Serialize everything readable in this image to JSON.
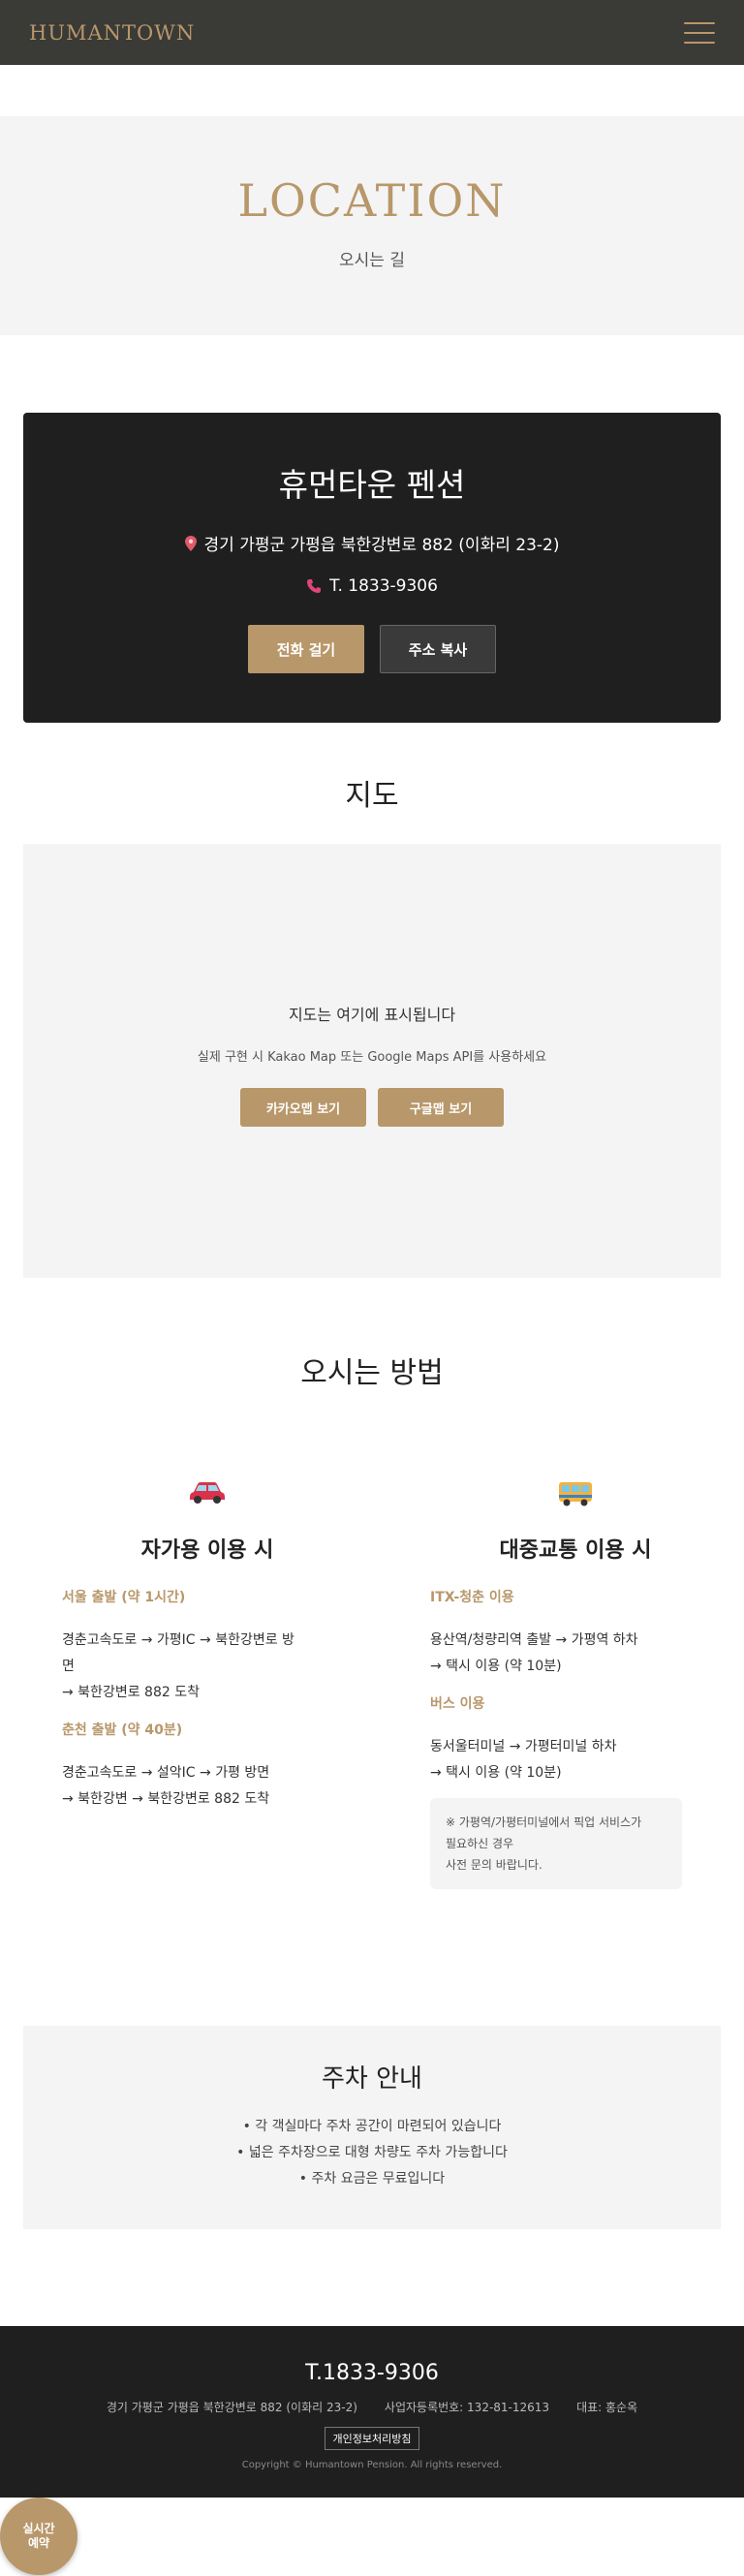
{
  "colors": {
    "accent": "#b8976a",
    "header_bg": "#3a3a37",
    "dark_bg": "#1f1f1f",
    "light_bg": "#f4f4f4"
  },
  "header": {
    "logo": "HUMANTOWN",
    "menu_icon": "hamburger-icon"
  },
  "hero": {
    "title": "LOCATION",
    "subtitle": "오시는 길"
  },
  "info": {
    "title": "휴먼타운 펜션",
    "address": "경기 가평군 가평읍 북한강변로 882 (이화리 23-2)",
    "phone": "T. 1833-9306",
    "call_button": "전화 걸기",
    "copy_button": "주소 복사",
    "address_icon": "map-pin-icon",
    "phone_icon": "phone-icon"
  },
  "map": {
    "title": "지도",
    "placeholder": "지도는 여기에 표시됩니다",
    "note": "실제 구현 시 Kakao Map 또는 Google Maps API를 사용하세요",
    "kakao_button": "카카오맵 보기",
    "google_button": "구글맵 보기"
  },
  "directions": {
    "title": "오시는 방법",
    "car": {
      "icon": "car-icon",
      "title": "자가용 이용 시",
      "routes": [
        {
          "head": "서울 출발 (약 1시간)",
          "lines": [
            "경춘고속도로 → 가평IC → 북한강변로 방",
            "면",
            "→ 북한강변로 882 도착"
          ]
        },
        {
          "head": "춘천 출발 (약 40분)",
          "lines": [
            "경춘고속도로 → 설악IC → 가평 방면",
            "→ 북한강변 → 북한강변로 882 도착"
          ]
        }
      ]
    },
    "transit": {
      "icon": "bus-icon",
      "title": "대중교통 이용 시",
      "routes": [
        {
          "head": "ITX-청춘 이용",
          "lines": [
            "용산역/청량리역 출발 → 가평역 하차",
            "→ 택시 이용 (약 10분)"
          ]
        },
        {
          "head": "버스 이용",
          "lines": [
            "동서울터미널 → 가평터미널 하차",
            "→ 택시 이용 (약 10분)"
          ]
        }
      ],
      "note": [
        "※ 가평역/가평터미널에서 픽업 서비스가",
        "필요하신 경우",
        "사전 문의 바랍니다."
      ]
    }
  },
  "parking": {
    "title": "주차 안내",
    "items": [
      "• 각 객실마다 주차 공간이 마련되어 있습니다",
      "• 넓은 주차장으로 대형 차량도 주차 가능합니다",
      "• 주차 요금은 무료입니다"
    ]
  },
  "footer": {
    "phone": "T.1833-9306",
    "address": "경기 가평군 가평읍 북한강변로 882 (이화리 23-2)",
    "biz_no": "사업자등록번호: 132-81-12613",
    "ceo": "대표: 홍순옥",
    "policy": "개인정보처리방침",
    "copyright": "Copyright © Humantown Pension. All rights reserved."
  },
  "fab": {
    "line1": "실시간",
    "line2": "예약"
  }
}
